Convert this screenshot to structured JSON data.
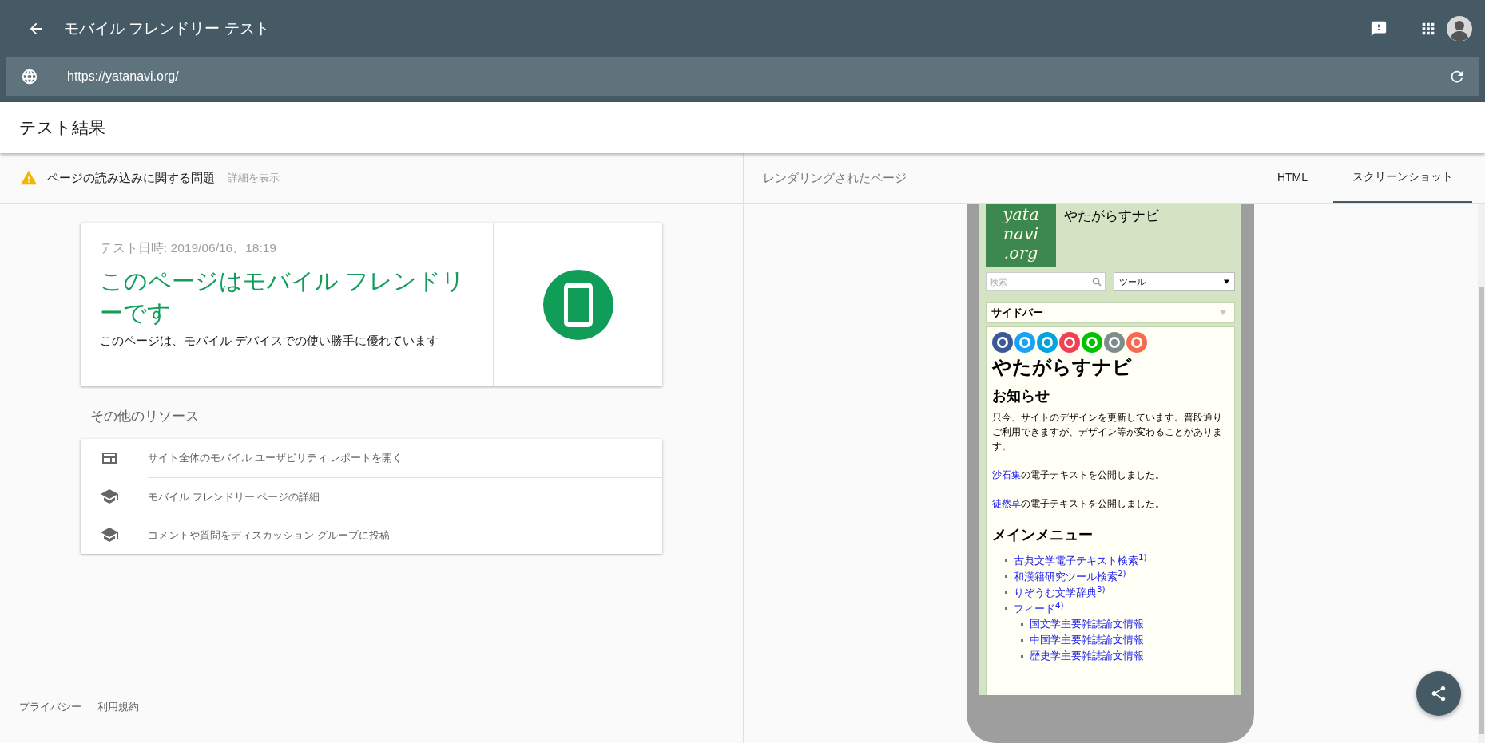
{
  "app_bar": {
    "title": "モバイル フレンドリー テスト"
  },
  "url_field": {
    "value": "https://yatanavi.org/"
  },
  "results_header": {
    "title": "テスト結果"
  },
  "issue": {
    "text": "ページの読み込みに関する問題",
    "link": "詳細を表示"
  },
  "result_card": {
    "date": "テスト日時: 2019/06/16、18:19",
    "headline": "このページはモバイル フレンドリーです",
    "description": "このページは、モバイル デバイスでの使い勝手に優れています"
  },
  "resources": {
    "title": "その他のリソース",
    "items": [
      {
        "kind": "report",
        "label": "サイト全体のモバイル ユーザビリティ レポートを開く"
      },
      {
        "kind": "learn",
        "label": "モバイル フレンドリー ページの詳細"
      },
      {
        "kind": "learn",
        "label": "コメントや質問をディスカッション グループに投稿"
      }
    ]
  },
  "footer_links": [
    "プライバシー",
    "利用規約"
  ],
  "rendered_panel": {
    "title": "レンダリングされたページ",
    "tabs": [
      {
        "label": "HTML",
        "selected": false
      },
      {
        "label": "スクリーンショット",
        "selected": true
      }
    ]
  },
  "screenshot": {
    "logo_lines": [
      "yata",
      "navi",
      ".org"
    ],
    "site_title": "やたがらすナビ",
    "search_placeholder": "検索",
    "select_value": "ツール",
    "sidebar_label": "サイドバー",
    "heading": "やたがらすナビ",
    "notice_heading": "お知らせ",
    "paragraphs": [
      {
        "text": "只今、サイトのデザインを更新しています。普段通りご利用できますが、デザイン等が変わることがあります。"
      },
      {
        "link": "沙石集",
        "text": "の電子テキストを公開しました。"
      },
      {
        "link": "徒然草",
        "text": "の電子テキストを公開しました。"
      }
    ],
    "menu_heading": "メインメニュー",
    "menu": [
      {
        "label": "古典文学電子テキスト検索$^{1)}$"
      },
      {
        "label": "和漢籍研究ツール検索$^{2)}$"
      },
      {
        "label": "りぞうむ文学辞典$^{3)}$"
      },
      {
        "label": "フィード$^{4)}$",
        "children": [
          {
            "label": "国文学主要雑誌論文情報"
          },
          {
            "label": "中国学主要雑誌論文情報"
          },
          {
            "label": "歴史学主要雑誌論文情報"
          }
        ]
      }
    ]
  }
}
